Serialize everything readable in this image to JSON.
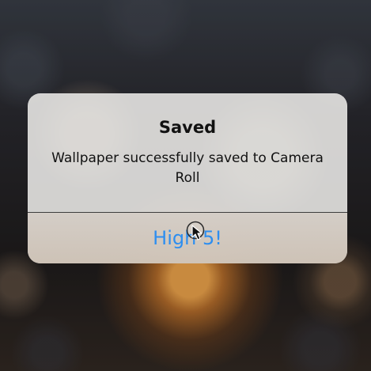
{
  "alert": {
    "title": "Saved",
    "message": "Wallpaper successfully saved to Camera Roll",
    "action_label": "High 5!"
  },
  "colors": {
    "accent": "#2d8ef0",
    "text": "#111111",
    "divider": "#3e3e3e"
  },
  "icons": {
    "cursor": "mouse-cursor-icon"
  }
}
